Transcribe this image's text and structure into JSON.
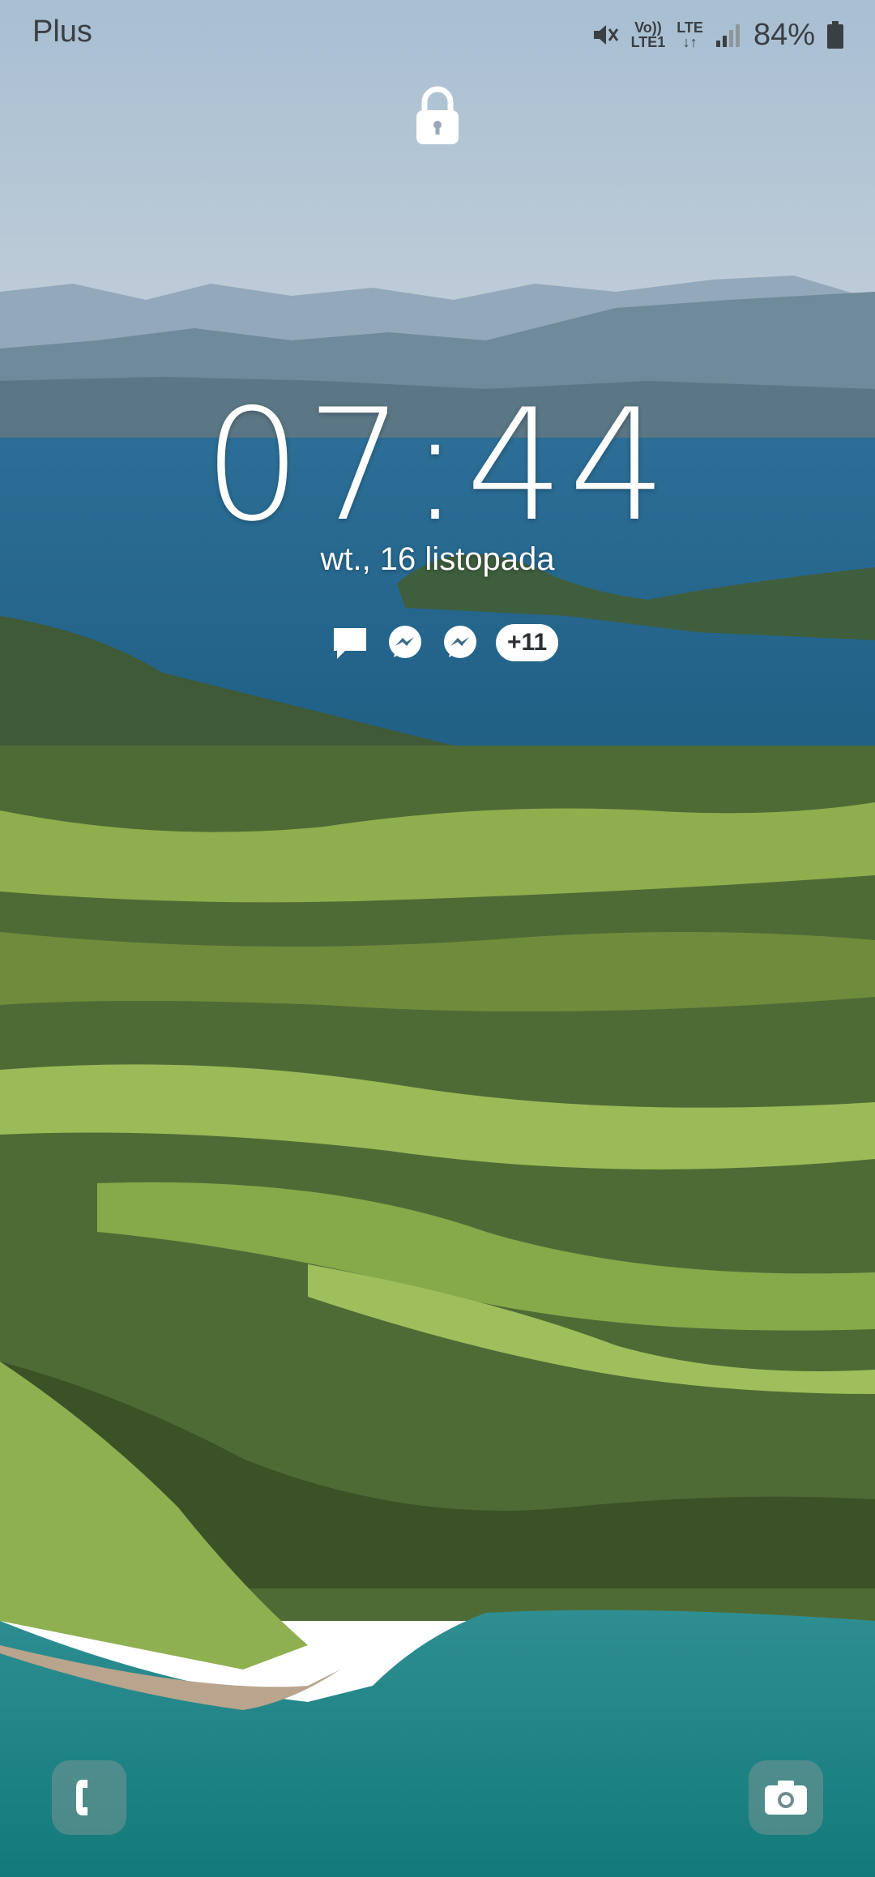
{
  "status_bar": {
    "carrier": "Plus",
    "volte_line1": "Vo))",
    "volte_line2": "LTE1",
    "lte_label": "LTE",
    "battery_percent": "84%",
    "icons": [
      "mute-icon",
      "volte-icon",
      "lte-data-icon",
      "signal-icon",
      "battery-icon"
    ]
  },
  "lock_screen": {
    "clock": "07:44",
    "date": "wt., 16 listopada",
    "notification_icons": [
      "message-icon",
      "messenger-icon",
      "messenger-icon"
    ],
    "more_notifications": "+11"
  },
  "shortcuts": {
    "left": "phone-icon",
    "right": "camera-icon"
  }
}
